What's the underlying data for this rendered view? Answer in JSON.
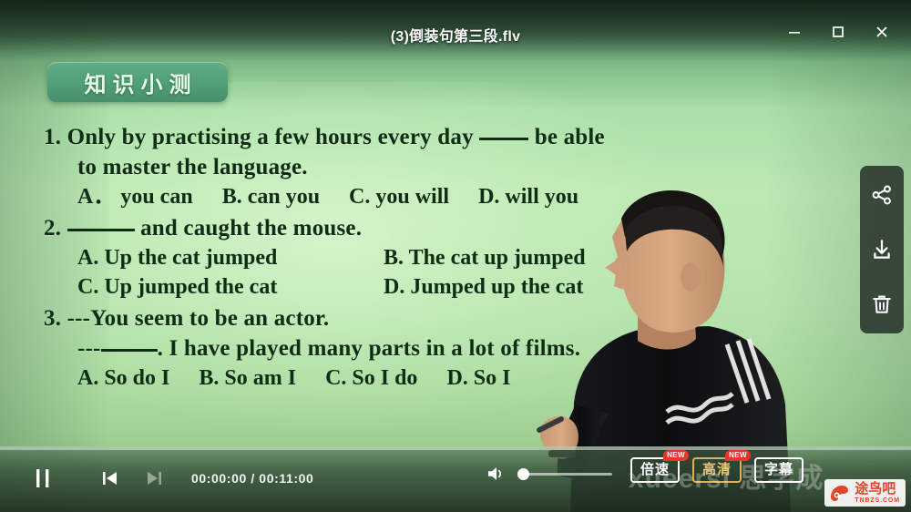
{
  "window": {
    "title": "(3)倒装句第三段.flv",
    "minimize_label": "—",
    "maximize_label": "□",
    "close_label": "✕"
  },
  "slide": {
    "badge": "知识小测",
    "questions": [
      {
        "number": "1.",
        "line1_before": "Only by practising a few hours every day",
        "line1_after": "be able",
        "line2": "to master the language.",
        "options": [
          "A． you can",
          "B. can you",
          "C. you will",
          "D. will you"
        ]
      },
      {
        "number": "2.",
        "line1_before": "",
        "line1_after": "and caught the mouse.",
        "options": [
          "A. Up the cat jumped",
          "B. The cat up jumped",
          "C. Up jumped the cat",
          "D. Jumped up the cat"
        ]
      },
      {
        "number": "3.",
        "line1": "---You seem to be an actor.",
        "line2_before": "---",
        "line2_after": ". I have played many parts in a lot of films.",
        "options": [
          "A. So do I",
          "B. So am I",
          "C. So I do",
          "D. So I"
        ]
      }
    ]
  },
  "side_rail": {
    "share_label": "share-icon",
    "download_label": "download-icon",
    "delete_label": "delete-icon"
  },
  "controls": {
    "pause_label": "pause-icon",
    "previous_label": "previous-icon",
    "next_label": "next-icon",
    "current_time": "00:00:00",
    "separator": "/",
    "total_time": "00:11:00",
    "time_display": "00:00:00 / 00:11:00",
    "volume_label": "volume-icon",
    "volume_percent": 6,
    "progress_percent": 0,
    "buttons": [
      {
        "label": "倍速",
        "badge": "NEW",
        "style": "white"
      },
      {
        "label": "高清",
        "badge": "NEW",
        "style": "gold"
      },
      {
        "label": "字幕",
        "badge": "",
        "style": "white"
      }
    ]
  },
  "watermarks": {
    "brand_text": "xueersi 思学成",
    "logo_cn": "途鸟吧",
    "logo_en": "TNBZS.COM"
  },
  "colors": {
    "board_green": "#b7e4ae",
    "badge_green": "#4f9d74",
    "text_dark": "#0f2d14",
    "accent_gold": "#d9b45a",
    "badge_red": "#e8342a",
    "logo_red": "#e2452a"
  }
}
